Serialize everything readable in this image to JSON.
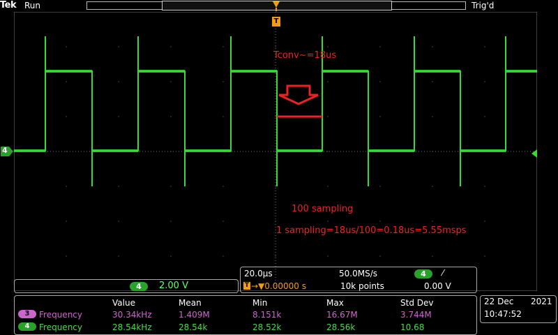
{
  "topbar": {
    "brand": "Tek",
    "run_state": "Run",
    "trigger_state": "Trig'd"
  },
  "trigger_position_marker": "T",
  "channel4": {
    "badge": "4",
    "color": "#33dd33",
    "scale": "2.00 V"
  },
  "annotations": {
    "tconv": "Tconv~=18us",
    "sampling_count": "100 sampling",
    "sampling_calc": "1 sampling=18us/100=0.18us=5.55msps",
    "color": "#ee2222"
  },
  "timebase": {
    "time_per_div": "20.0µs",
    "sample_rate": "50.0MS/s",
    "trigger_source": "4",
    "trigger_slope": "⁄",
    "trigger_marker": "T",
    "trigger_offset": "→▼0.00000 s",
    "record_length": "10k points",
    "trigger_level": "0.00 V"
  },
  "measurements": {
    "headers": [
      "Value",
      "Mean",
      "Min",
      "Max",
      "Std Dev"
    ],
    "rows": [
      {
        "channel": "3",
        "name": "Frequency",
        "value": "30.34kHz",
        "mean": "1.409M",
        "min": "8.151k",
        "max": "16.67M",
        "std": "3.744M",
        "color": "#cc66cc"
      },
      {
        "channel": "4",
        "name": "Frequency",
        "value": "28.54kHz",
        "mean": "28.54k",
        "min": "28.52k",
        "max": "28.56k",
        "std": "10.68",
        "color": "#44dd44"
      }
    ]
  },
  "datetime": {
    "date_day": "22 Dec",
    "year": "2021",
    "time": "10:47:52"
  }
}
